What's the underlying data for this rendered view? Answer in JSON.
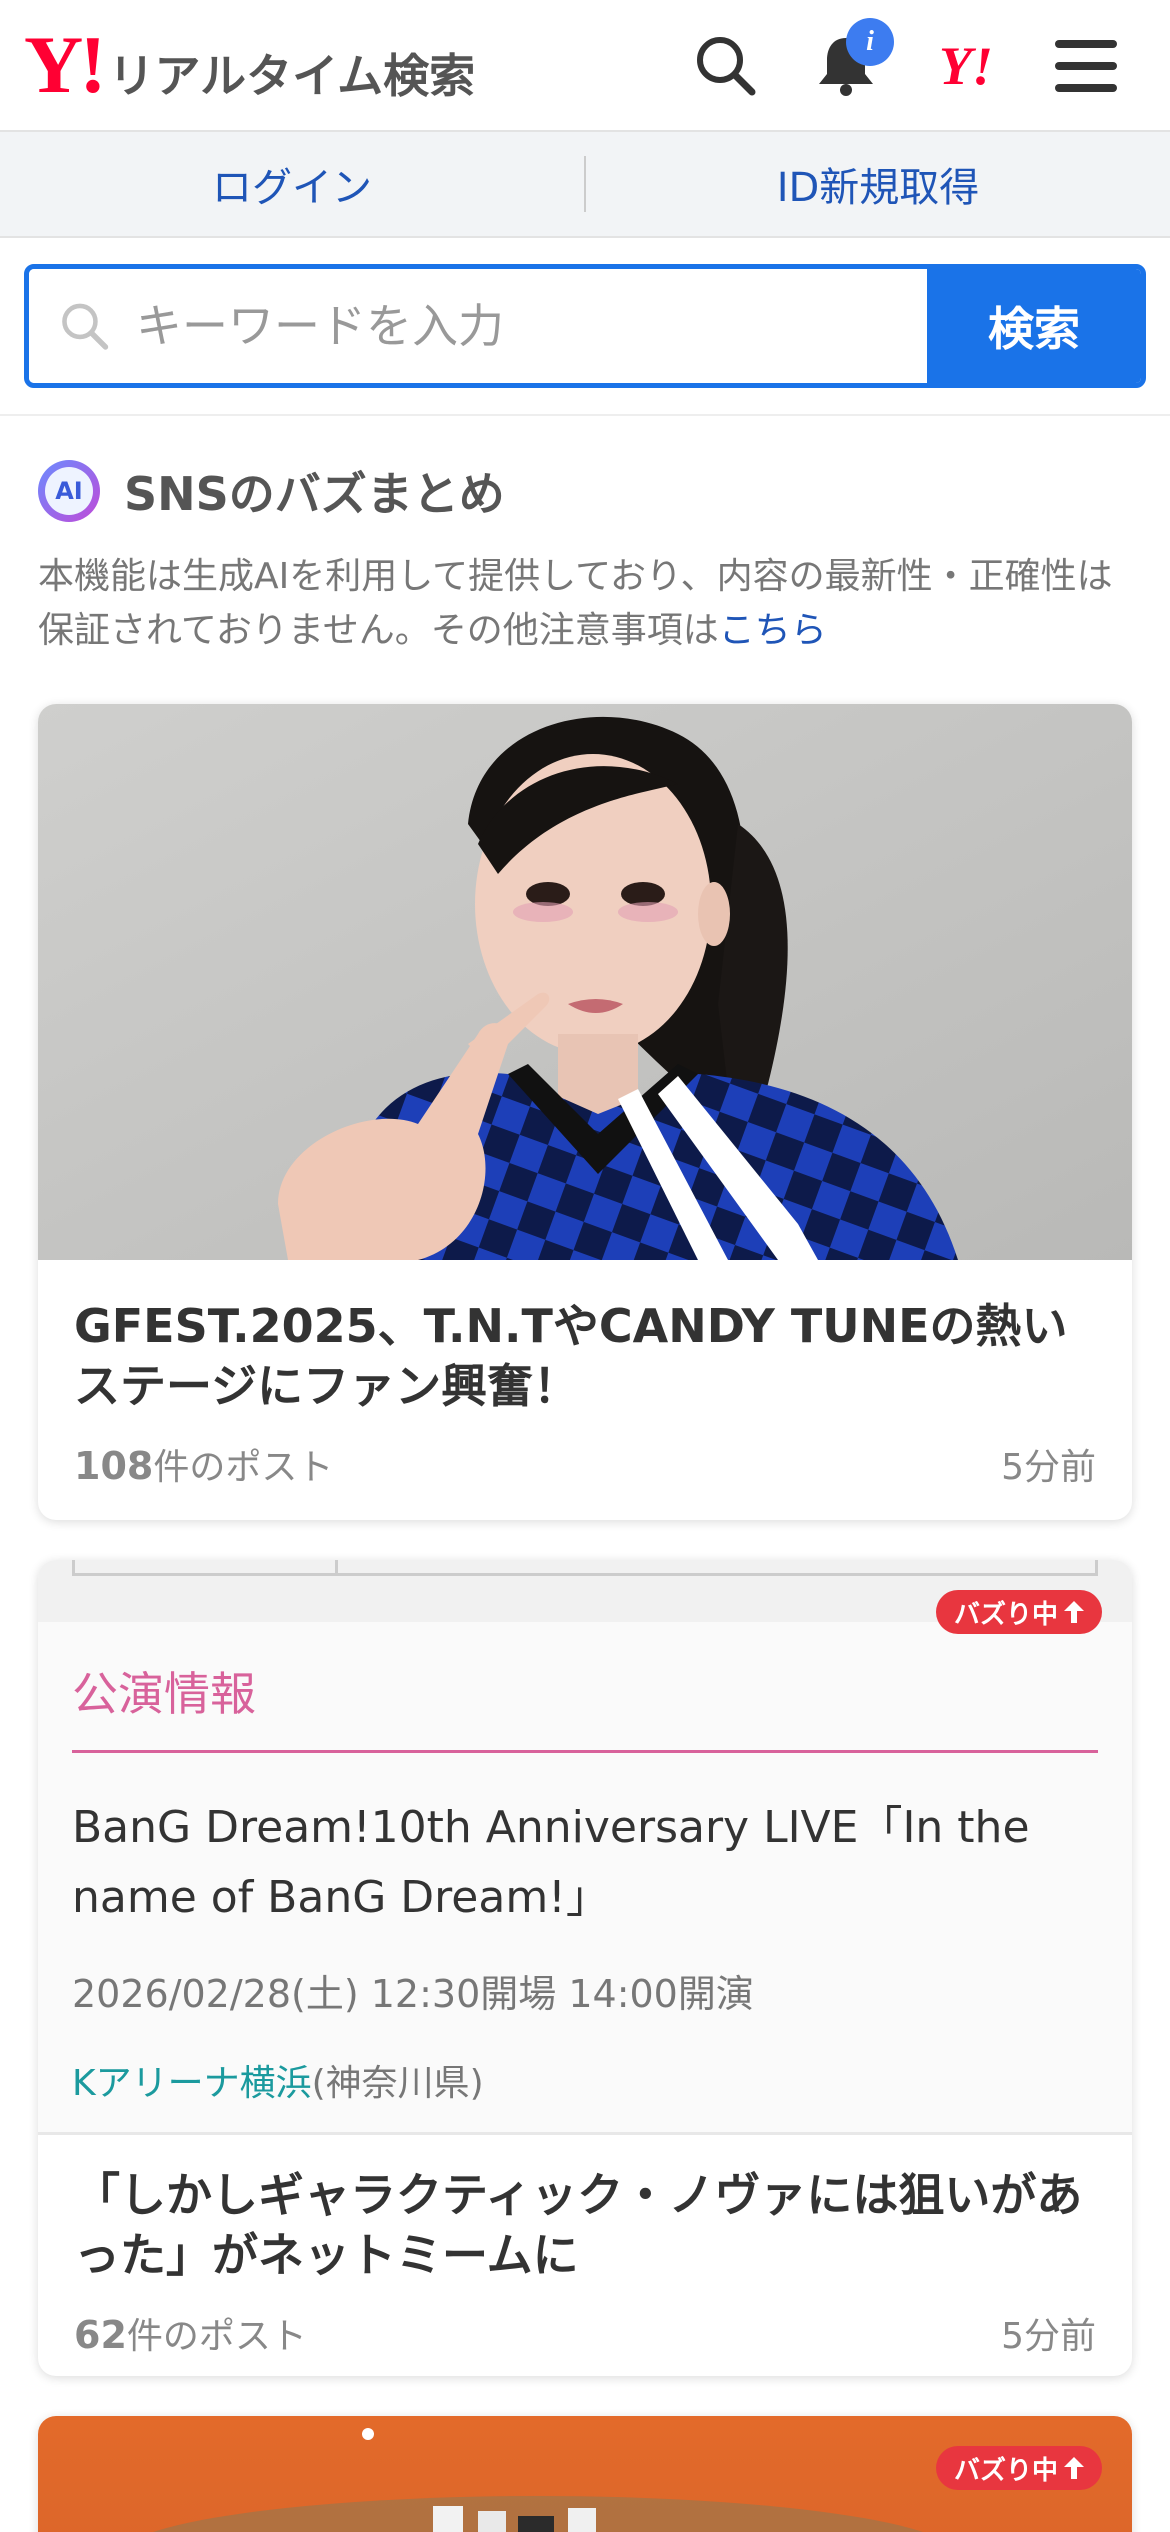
{
  "header": {
    "logo_mark": "Y!",
    "logo_text": "リアルタイム検索",
    "notification_badge": "i",
    "yahoo_mark": "Y!"
  },
  "auth": {
    "login": "ログイン",
    "register": "ID新規取得"
  },
  "search": {
    "placeholder": "キーワードを入力",
    "button": "検索"
  },
  "section": {
    "ai_badge": "AI",
    "title": "SNSのバズまとめ",
    "disclaimer": "本機能は生成AIを利用して提供しており、内容の最新性・正確性は保証されておりません。その他注意事項は",
    "disclaimer_link": "こちら"
  },
  "cards": [
    {
      "title": "GFEST.2025、T.N.TやCANDY TUNEの熱いステージにファン興奮！",
      "count": "108",
      "count_suffix": "件のポスト",
      "time": "5分前"
    },
    {
      "buzz": "バズり中",
      "event_label": "公演情報",
      "event_title": "BanG Dream!10th Anniversary LIVE「In the name of BanG Dream!」",
      "event_date": "2026/02/28(土) 12:30開場 14:00開演",
      "venue_name": "Kアリーナ横浜",
      "venue_pref": "(神奈川県)",
      "title": "「しかしギャラクティック・ノヴァには狙いがあった」がネットミームに",
      "count": "62",
      "count_suffix": "件のポスト",
      "time": "5分前"
    },
    {
      "buzz": "バズり中"
    }
  ],
  "colors": {
    "brand_red": "#ff0033",
    "accent_blue": "#1a73e8",
    "link_blue": "#1f55b7",
    "event_pink": "#d8629b",
    "venue_teal": "#1b9a9e",
    "buzz_red": "#e8363f"
  },
  "icons": [
    "search-icon",
    "bell-icon",
    "menu-icon",
    "magnifier-icon",
    "ai-icon",
    "arrow-up-icon"
  ]
}
